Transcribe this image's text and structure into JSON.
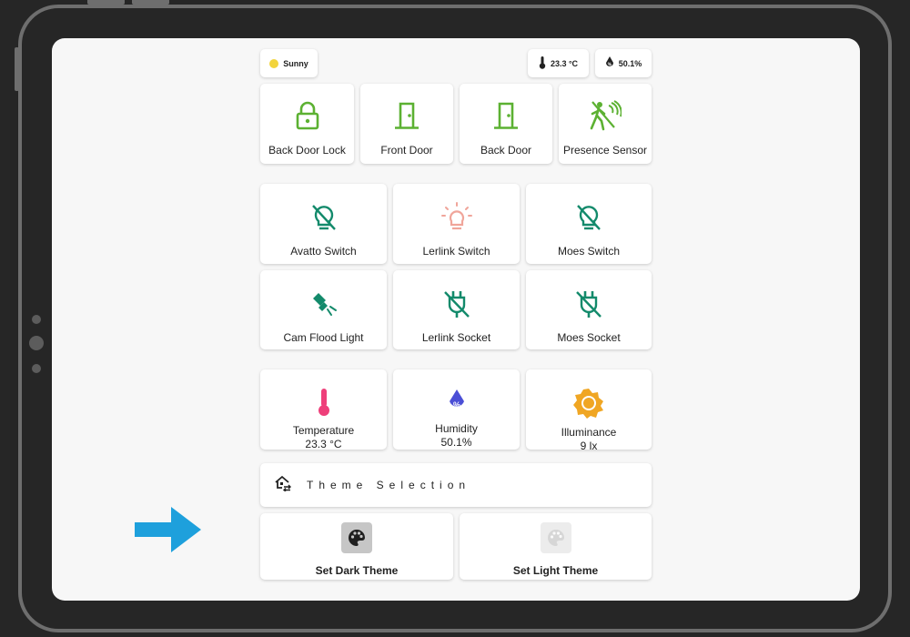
{
  "header": {
    "weather": {
      "label": "Sunny",
      "icon": "sun-dot-icon",
      "color": "#f2d43c"
    },
    "temperature": {
      "label": "23.3 °C",
      "icon": "thermometer-icon"
    },
    "humidity": {
      "label": "50.1%",
      "icon": "water-percent-icon"
    }
  },
  "doors": [
    {
      "label": "Back Door Lock",
      "icon": "lock-icon"
    },
    {
      "label": "Front Door",
      "icon": "door-icon"
    },
    {
      "label": "Back Door",
      "icon": "door-icon"
    },
    {
      "label": "Presence Sensor",
      "icon": "motion-sensor-icon"
    }
  ],
  "switches": [
    {
      "label": "Avatto Switch",
      "icon": "lightbulb-off-icon"
    },
    {
      "label": "Lerlink Switch",
      "icon": "lightbulb-on-icon"
    },
    {
      "label": "Moes Switch",
      "icon": "lightbulb-off-icon"
    },
    {
      "label": "Cam Flood Light",
      "icon": "flashlight-icon"
    },
    {
      "label": "Lerlink Socket",
      "icon": "power-plug-off-icon"
    },
    {
      "label": "Moes Socket",
      "icon": "power-plug-off-icon"
    }
  ],
  "sensors": [
    {
      "label": "Temperature",
      "value": "23.3 °C",
      "icon": "thermometer-icon"
    },
    {
      "label": "Humidity",
      "value": "50.1%",
      "icon": "water-percent-icon"
    },
    {
      "label": "Illuminance",
      "value": "9 lx",
      "icon": "brightness-icon"
    }
  ],
  "theme": {
    "title": "Theme Selection",
    "icon": "home-swap-icon",
    "dark_button": {
      "label": "Set Dark Theme",
      "icon": "palette-icon"
    },
    "light_button": {
      "label": "Set Light Theme",
      "icon": "palette-icon"
    }
  },
  "colors": {
    "green": "#5cb132",
    "teal": "#138a6b",
    "pink": "#f0a59a",
    "temp": "#ee3f7a",
    "humidity": "#4b4fd6",
    "illuminance": "#f0a623",
    "arrow": "#1ea0dc"
  }
}
